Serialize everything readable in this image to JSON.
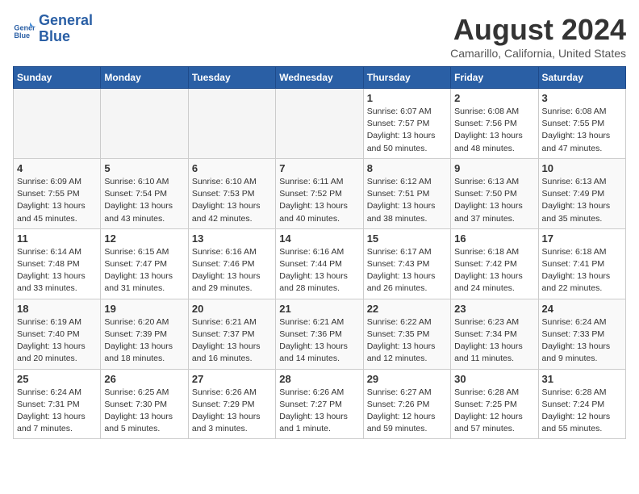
{
  "header": {
    "logo_line1": "General",
    "logo_line2": "Blue",
    "month_title": "August 2024",
    "location": "Camarillo, California, United States"
  },
  "weekdays": [
    "Sunday",
    "Monday",
    "Tuesday",
    "Wednesday",
    "Thursday",
    "Friday",
    "Saturday"
  ],
  "weeks": [
    [
      {
        "day": "",
        "info": ""
      },
      {
        "day": "",
        "info": ""
      },
      {
        "day": "",
        "info": ""
      },
      {
        "day": "",
        "info": ""
      },
      {
        "day": "1",
        "info": "Sunrise: 6:07 AM\nSunset: 7:57 PM\nDaylight: 13 hours\nand 50 minutes."
      },
      {
        "day": "2",
        "info": "Sunrise: 6:08 AM\nSunset: 7:56 PM\nDaylight: 13 hours\nand 48 minutes."
      },
      {
        "day": "3",
        "info": "Sunrise: 6:08 AM\nSunset: 7:55 PM\nDaylight: 13 hours\nand 47 minutes."
      }
    ],
    [
      {
        "day": "4",
        "info": "Sunrise: 6:09 AM\nSunset: 7:55 PM\nDaylight: 13 hours\nand 45 minutes."
      },
      {
        "day": "5",
        "info": "Sunrise: 6:10 AM\nSunset: 7:54 PM\nDaylight: 13 hours\nand 43 minutes."
      },
      {
        "day": "6",
        "info": "Sunrise: 6:10 AM\nSunset: 7:53 PM\nDaylight: 13 hours\nand 42 minutes."
      },
      {
        "day": "7",
        "info": "Sunrise: 6:11 AM\nSunset: 7:52 PM\nDaylight: 13 hours\nand 40 minutes."
      },
      {
        "day": "8",
        "info": "Sunrise: 6:12 AM\nSunset: 7:51 PM\nDaylight: 13 hours\nand 38 minutes."
      },
      {
        "day": "9",
        "info": "Sunrise: 6:13 AM\nSunset: 7:50 PM\nDaylight: 13 hours\nand 37 minutes."
      },
      {
        "day": "10",
        "info": "Sunrise: 6:13 AM\nSunset: 7:49 PM\nDaylight: 13 hours\nand 35 minutes."
      }
    ],
    [
      {
        "day": "11",
        "info": "Sunrise: 6:14 AM\nSunset: 7:48 PM\nDaylight: 13 hours\nand 33 minutes."
      },
      {
        "day": "12",
        "info": "Sunrise: 6:15 AM\nSunset: 7:47 PM\nDaylight: 13 hours\nand 31 minutes."
      },
      {
        "day": "13",
        "info": "Sunrise: 6:16 AM\nSunset: 7:46 PM\nDaylight: 13 hours\nand 29 minutes."
      },
      {
        "day": "14",
        "info": "Sunrise: 6:16 AM\nSunset: 7:44 PM\nDaylight: 13 hours\nand 28 minutes."
      },
      {
        "day": "15",
        "info": "Sunrise: 6:17 AM\nSunset: 7:43 PM\nDaylight: 13 hours\nand 26 minutes."
      },
      {
        "day": "16",
        "info": "Sunrise: 6:18 AM\nSunset: 7:42 PM\nDaylight: 13 hours\nand 24 minutes."
      },
      {
        "day": "17",
        "info": "Sunrise: 6:18 AM\nSunset: 7:41 PM\nDaylight: 13 hours\nand 22 minutes."
      }
    ],
    [
      {
        "day": "18",
        "info": "Sunrise: 6:19 AM\nSunset: 7:40 PM\nDaylight: 13 hours\nand 20 minutes."
      },
      {
        "day": "19",
        "info": "Sunrise: 6:20 AM\nSunset: 7:39 PM\nDaylight: 13 hours\nand 18 minutes."
      },
      {
        "day": "20",
        "info": "Sunrise: 6:21 AM\nSunset: 7:37 PM\nDaylight: 13 hours\nand 16 minutes."
      },
      {
        "day": "21",
        "info": "Sunrise: 6:21 AM\nSunset: 7:36 PM\nDaylight: 13 hours\nand 14 minutes."
      },
      {
        "day": "22",
        "info": "Sunrise: 6:22 AM\nSunset: 7:35 PM\nDaylight: 13 hours\nand 12 minutes."
      },
      {
        "day": "23",
        "info": "Sunrise: 6:23 AM\nSunset: 7:34 PM\nDaylight: 13 hours\nand 11 minutes."
      },
      {
        "day": "24",
        "info": "Sunrise: 6:24 AM\nSunset: 7:33 PM\nDaylight: 13 hours\nand 9 minutes."
      }
    ],
    [
      {
        "day": "25",
        "info": "Sunrise: 6:24 AM\nSunset: 7:31 PM\nDaylight: 13 hours\nand 7 minutes."
      },
      {
        "day": "26",
        "info": "Sunrise: 6:25 AM\nSunset: 7:30 PM\nDaylight: 13 hours\nand 5 minutes."
      },
      {
        "day": "27",
        "info": "Sunrise: 6:26 AM\nSunset: 7:29 PM\nDaylight: 13 hours\nand 3 minutes."
      },
      {
        "day": "28",
        "info": "Sunrise: 6:26 AM\nSunset: 7:27 PM\nDaylight: 13 hours\nand 1 minute."
      },
      {
        "day": "29",
        "info": "Sunrise: 6:27 AM\nSunset: 7:26 PM\nDaylight: 12 hours\nand 59 minutes."
      },
      {
        "day": "30",
        "info": "Sunrise: 6:28 AM\nSunset: 7:25 PM\nDaylight: 12 hours\nand 57 minutes."
      },
      {
        "day": "31",
        "info": "Sunrise: 6:28 AM\nSunset: 7:24 PM\nDaylight: 12 hours\nand 55 minutes."
      }
    ]
  ]
}
